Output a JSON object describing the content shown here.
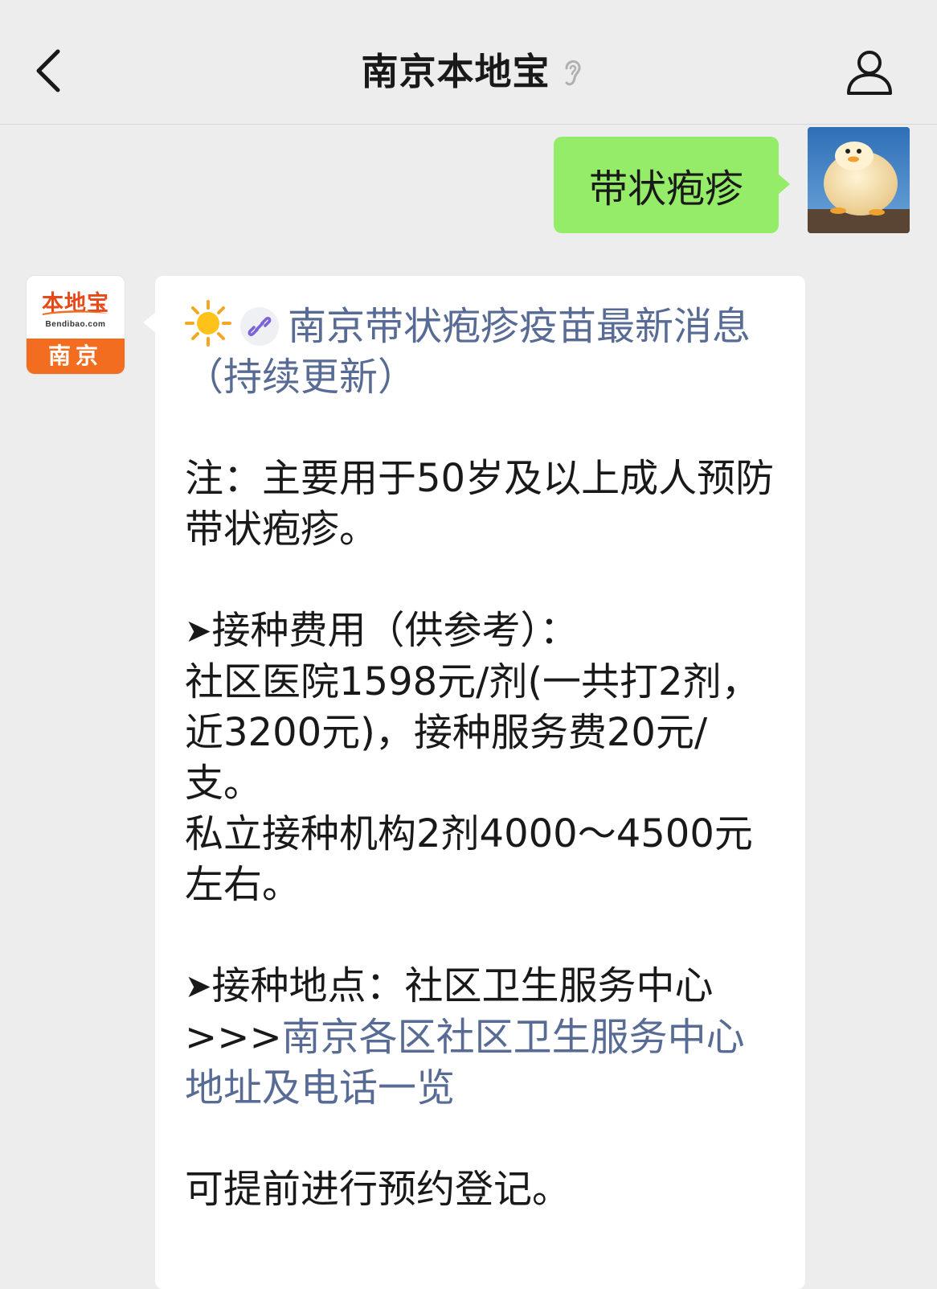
{
  "navbar": {
    "title": "南京本地宝"
  },
  "user_message": {
    "text": "带状疱疹"
  },
  "official_account": {
    "logo_name": "本地宝",
    "logo_url": "Bendibao.com",
    "logo_city": "南京"
  },
  "reply": {
    "article_link": "南京带状疱疹疫苗最新消息（持续更新）",
    "note": "注：主要用于50岁及以上成人预防带状疱疹。",
    "fee_heading": "接种费用（供参考）：",
    "fee_community": "社区医院1598元/剂(一共打2剂，近3200元)，接种服务费20元/支。",
    "fee_private": "私立接种机构2剂4000～4500元左右。",
    "location_heading": "接种地点：社区卫生服务中心",
    "location_prefix": ">>>",
    "location_link": "南京各区社区卫生服务中心地址及电话一览",
    "booking": "可提前进行预约登记。"
  },
  "colors": {
    "background": "#ededed",
    "user_bubble": "#95ec69",
    "link": "#576b95",
    "logo_orange": "#f26d1f"
  },
  "icons": [
    "back-arrow-icon",
    "ear-icon",
    "profile-icon",
    "sun-icon",
    "link-icon"
  ]
}
